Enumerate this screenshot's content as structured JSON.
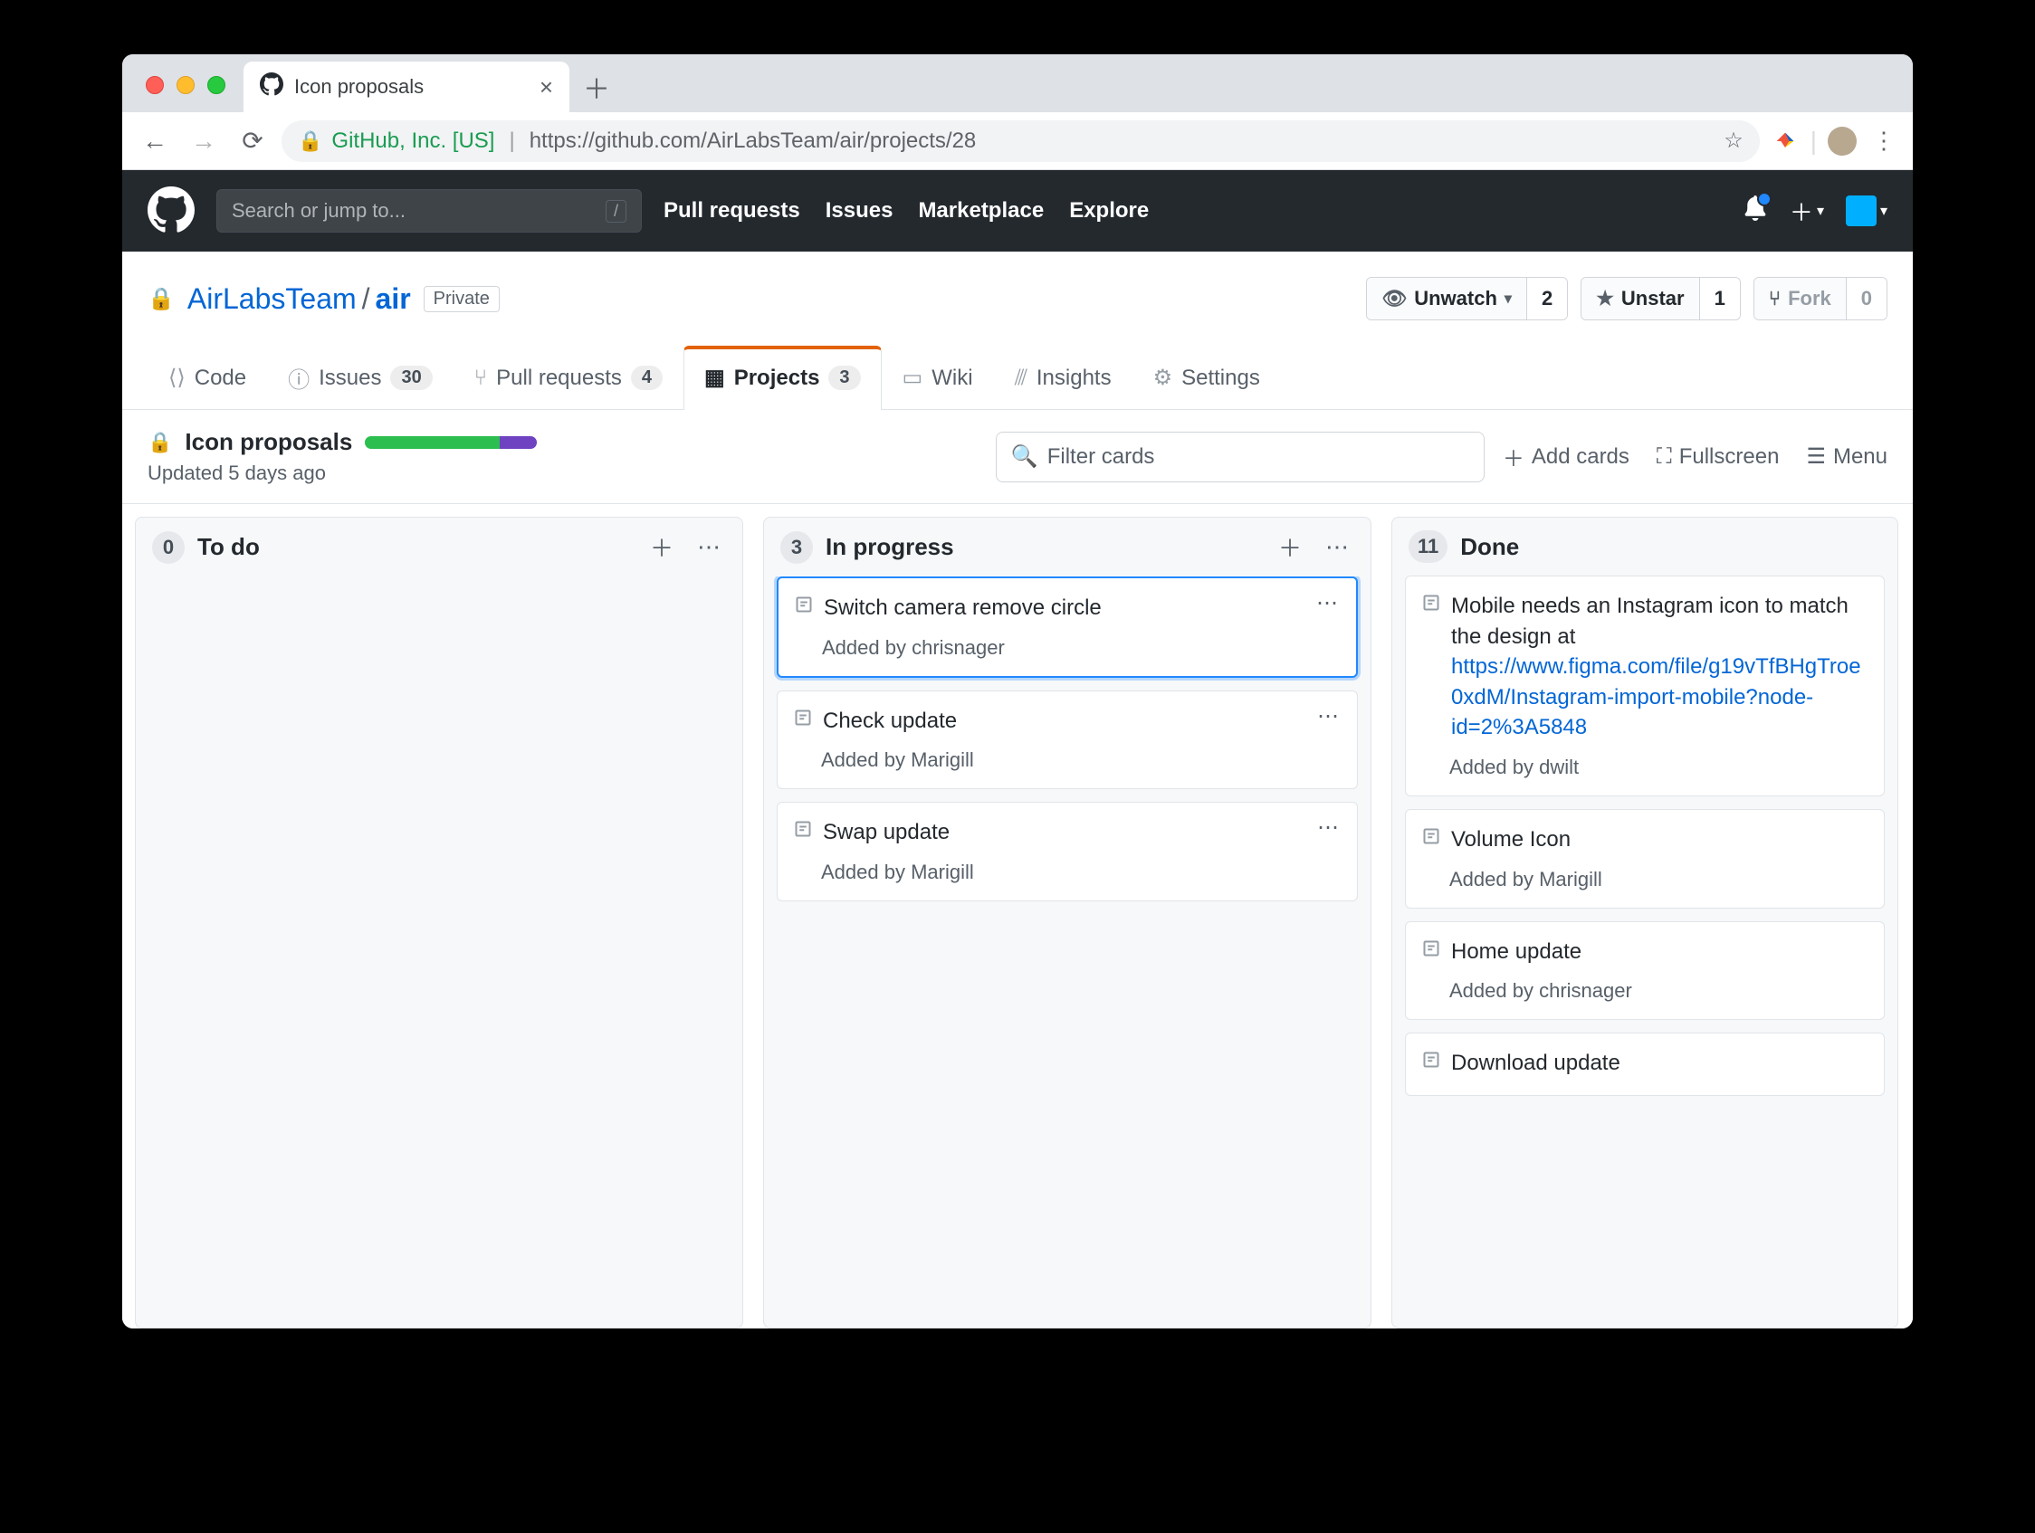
{
  "browser": {
    "tab_title": "Icon proposals",
    "url_org": "GitHub, Inc. [US]",
    "url_text": "https://github.com/AirLabsTeam/air/projects/28"
  },
  "gh_header": {
    "search_placeholder": "Search or jump to...",
    "nav": [
      "Pull requests",
      "Issues",
      "Marketplace",
      "Explore"
    ]
  },
  "repo": {
    "owner": "AirLabsTeam",
    "name": "air",
    "private_label": "Private",
    "actions": {
      "watch": {
        "label": "Unwatch",
        "count": "2"
      },
      "star": {
        "label": "Unstar",
        "count": "1"
      },
      "fork": {
        "label": "Fork",
        "count": "0"
      }
    },
    "tabs": {
      "code": "Code",
      "issues": {
        "label": "Issues",
        "count": "30"
      },
      "pulls": {
        "label": "Pull requests",
        "count": "4"
      },
      "projects": {
        "label": "Projects",
        "count": "3"
      },
      "wiki": "Wiki",
      "insights": "Insights",
      "settings": "Settings"
    }
  },
  "project": {
    "title": "Icon proposals",
    "updated": "Updated 5 days ago",
    "filter_placeholder": "Filter cards",
    "actions": {
      "add": "Add cards",
      "fullscreen": "Fullscreen",
      "menu": "Menu"
    },
    "progress": {
      "done_pct": 78,
      "in_progress_pct": 22
    }
  },
  "columns": [
    {
      "count": "0",
      "title": "To do",
      "cards": []
    },
    {
      "count": "3",
      "title": "In progress",
      "cards": [
        {
          "title": "Switch camera remove circle",
          "added_by": "chrisnager",
          "selected": true
        },
        {
          "title": "Check update",
          "added_by": "Marigill"
        },
        {
          "title": "Swap update",
          "added_by": "Marigill"
        }
      ]
    },
    {
      "count": "11",
      "title": "Done",
      "cards": [
        {
          "title_prefix": "Mobile needs an Instagram icon to match the design at ",
          "link": "https://www.figma.com/file/g19vTfBHgTroe0xdM/Instagram-import-mobile?node-id=2%3A5848",
          "added_by": "dwilt"
        },
        {
          "title": "Volume Icon",
          "added_by": "Marigill"
        },
        {
          "title": "Home update",
          "added_by": "chrisnager"
        },
        {
          "title": "Download update"
        }
      ]
    }
  ],
  "labels": {
    "added_by": "Added by"
  }
}
